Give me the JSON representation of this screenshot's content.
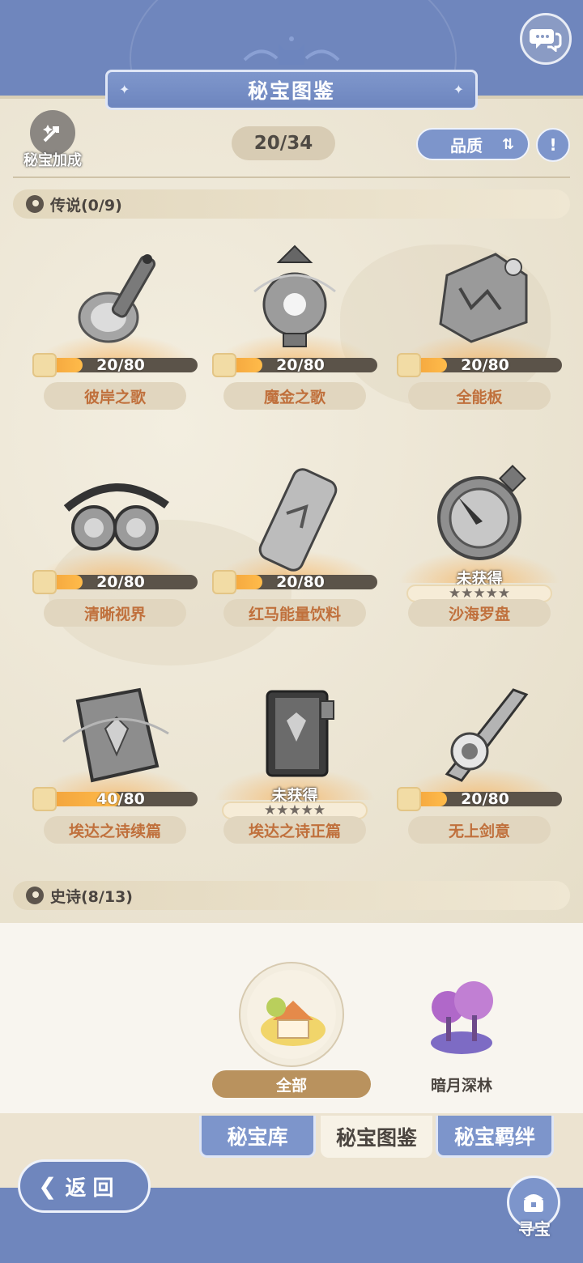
{
  "header": {
    "title": "秘宝图鉴",
    "bonus_label": "秘宝加成",
    "collected_count": "20/34",
    "sort_label": "品质",
    "info_icon": "info-icon",
    "chat_icon": "chat-bubbles-icon"
  },
  "sections": [
    {
      "label": "传说(0/9)",
      "items": [
        {
          "name": "彼岸之歌",
          "progress": "20/80",
          "fraction": 0.25,
          "obtained": true
        },
        {
          "name": "魔金之歌",
          "progress": "20/80",
          "fraction": 0.25,
          "obtained": true
        },
        {
          "name": "全能板",
          "progress": "20/80",
          "fraction": 0.25,
          "obtained": true
        },
        {
          "name": "清晰视界",
          "progress": "20/80",
          "fraction": 0.25,
          "obtained": true
        },
        {
          "name": "红马能量饮料",
          "progress": "20/80",
          "fraction": 0.25,
          "obtained": true
        },
        {
          "name": "沙海罗盘",
          "status": "未获得",
          "stars": "★★★★★",
          "obtained": false
        },
        {
          "name": "埃达之诗续篇",
          "progress": "40/80",
          "fraction": 0.5,
          "obtained": true
        },
        {
          "name": "埃达之诗正篇",
          "status": "未获得",
          "stars": "★★★★★",
          "obtained": false
        },
        {
          "name": "无上剑意",
          "progress": "20/80",
          "fraction": 0.25,
          "obtained": true
        }
      ]
    },
    {
      "label": "史诗(8/13)"
    }
  ],
  "regions": [
    {
      "label": "全部",
      "selected": true
    },
    {
      "label": "暗月深林",
      "selected": false
    }
  ],
  "tabs": [
    {
      "label": "秘宝库",
      "active": false
    },
    {
      "label": "秘宝图鉴",
      "active": true
    },
    {
      "label": "秘宝羁绊",
      "active": false
    }
  ],
  "footer": {
    "back_label": "返回",
    "treasure_label": "寻宝"
  },
  "colors": {
    "accent_blue": "#6f86bd",
    "progress_orange": "#f1a23c",
    "name_text": "#c0703c"
  }
}
